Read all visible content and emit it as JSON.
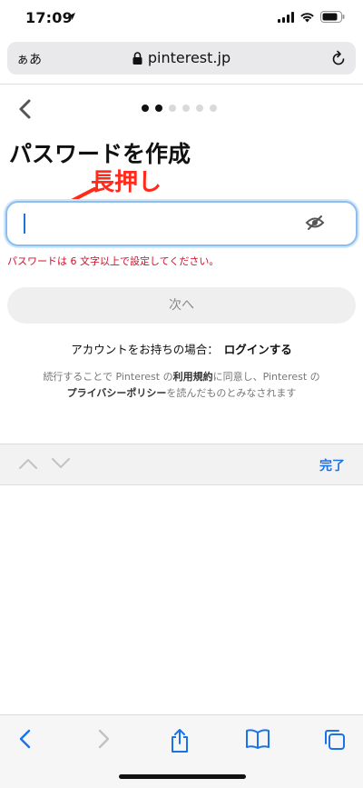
{
  "status_bar": {
    "time": "17:09"
  },
  "browser": {
    "text_size_label": "ぁあ",
    "domain": "pinterest.jp"
  },
  "signup": {
    "title": "パスワードを作成",
    "annotation": "長押し",
    "password_value": "",
    "error": "パスワードは 6 文字以上で設定してください。",
    "next_label": "次へ",
    "login_prompt": "アカウントをお持ちの場合：",
    "login_link": "ログインする",
    "terms_part1": "続行することで Pinterest の",
    "terms_link1": "利用規約",
    "terms_part2": "に同意し、Pinterest の",
    "terms_link2": "プライバシーポリシー",
    "terms_part3": "を読んだものとみなされます",
    "steps_total": 6,
    "steps_current": 2
  },
  "keyboard_accessory": {
    "done_label": "完了"
  },
  "colors": {
    "accent": "#1a73e8",
    "error": "#d0102a",
    "annotation": "#ff2a1a",
    "focus_border": "#8bbdf0"
  }
}
